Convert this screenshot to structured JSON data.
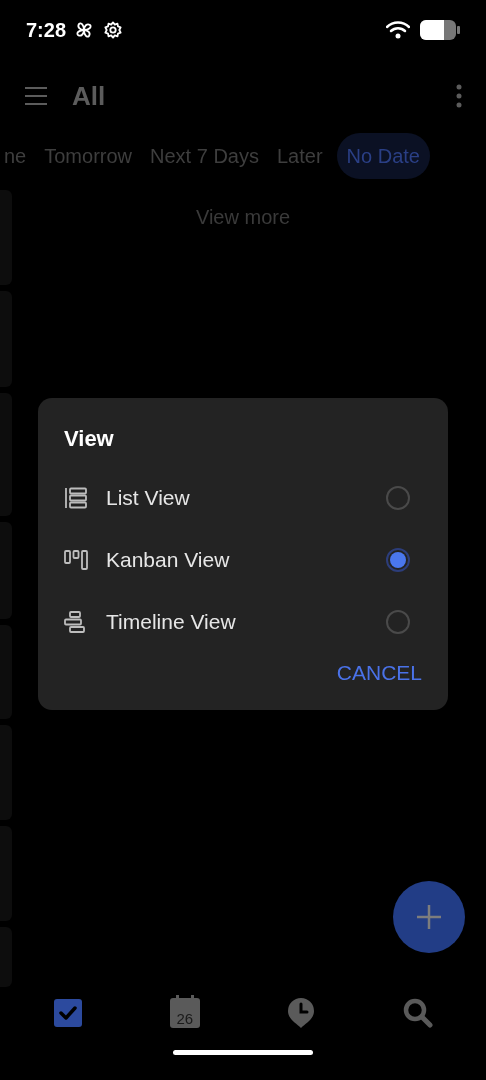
{
  "status_bar": {
    "time": "7:28"
  },
  "header": {
    "title": "All"
  },
  "tabs": [
    {
      "label": "ne",
      "selected": false
    },
    {
      "label": "Tomorrow",
      "selected": false
    },
    {
      "label": "Next 7 Days",
      "selected": false
    },
    {
      "label": "Later",
      "selected": false
    },
    {
      "label": "No Date",
      "selected": true
    }
  ],
  "view_more": "View more",
  "dialog": {
    "title": "View",
    "options": [
      {
        "kind": "list",
        "label": "List View",
        "selected": false
      },
      {
        "kind": "kanban",
        "label": "Kanban View",
        "selected": true
      },
      {
        "kind": "timeline",
        "label": "Timeline View",
        "selected": false
      }
    ],
    "cancel": "CANCEL"
  },
  "bottom_nav": [
    {
      "kind": "tasks",
      "selected": true
    },
    {
      "kind": "calendar",
      "label": "26",
      "selected": false
    },
    {
      "kind": "clock",
      "selected": false
    },
    {
      "kind": "search",
      "selected": false
    }
  ]
}
